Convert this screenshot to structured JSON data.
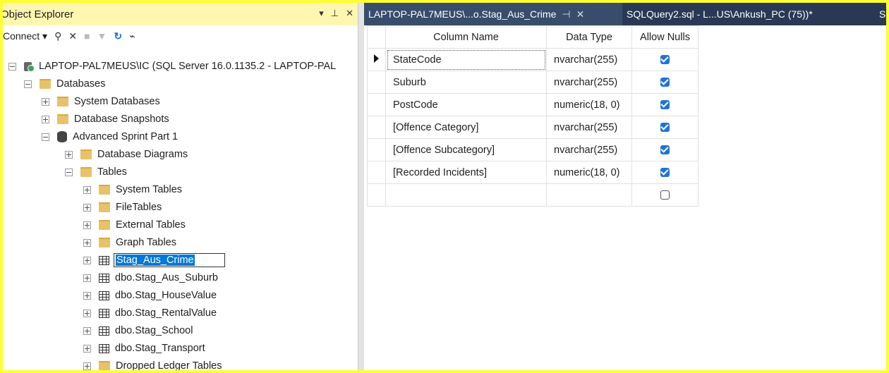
{
  "object_explorer": {
    "title": "Object Explorer",
    "title_buttons": [
      "▾",
      "ᵖ",
      "✕"
    ],
    "toolbar": {
      "connect_label": "Connect ▾"
    },
    "tree": {
      "server": "LAPTOP-PAL7MEUS\\IC (SQL Server 16.0.1135.2 - LAPTOP-PAL",
      "databases": "Databases",
      "system_databases": "System Databases",
      "database_snapshots": "Database Snapshots",
      "db_name": "Advanced Sprint Part 1",
      "database_diagrams": "Database Diagrams",
      "tables": "Tables",
      "system_tables": "System Tables",
      "file_tables": "FileTables",
      "external_tables": "External Tables",
      "graph_tables": "Graph Tables",
      "renaming_table": "Stag_Aus_Crime",
      "table_items": [
        "dbo.Stag_Aus_Suburb",
        "dbo.Stag_HouseValue",
        "dbo.Stag_RentalValue",
        "dbo.Stag_School",
        "dbo.Stag_Transport"
      ],
      "dropped_ledger_tables": "Dropped Ledger Tables"
    }
  },
  "tabs": [
    {
      "label": "LAPTOP-PAL7MEUS\\...o.Stag_Aus_Crime",
      "pin": "⊣",
      "close": "✕",
      "active": true
    },
    {
      "label": "SQLQuery2.sql - L...US\\Ankush_PC (75))*",
      "active": false
    },
    {
      "label": "S",
      "active": false
    }
  ],
  "designer": {
    "headers": {
      "column_name": "Column Name",
      "data_type": "Data Type",
      "allow_nulls": "Allow Nulls"
    },
    "rows": [
      {
        "name": "StateCode",
        "type": "nvarchar(255)",
        "nullable": true
      },
      {
        "name": "Suburb",
        "type": "nvarchar(255)",
        "nullable": true
      },
      {
        "name": "PostCode",
        "type": "numeric(18, 0)",
        "nullable": true
      },
      {
        "name": "[Offence Category]",
        "type": "nvarchar(255)",
        "nullable": true
      },
      {
        "name": "[Offence Subcategory]",
        "type": "nvarchar(255)",
        "nullable": true
      },
      {
        "name": "[Recorded Incidents]",
        "type": "numeric(18, 0)",
        "nullable": true
      },
      {
        "name": "",
        "type": "",
        "nullable": false
      }
    ]
  }
}
